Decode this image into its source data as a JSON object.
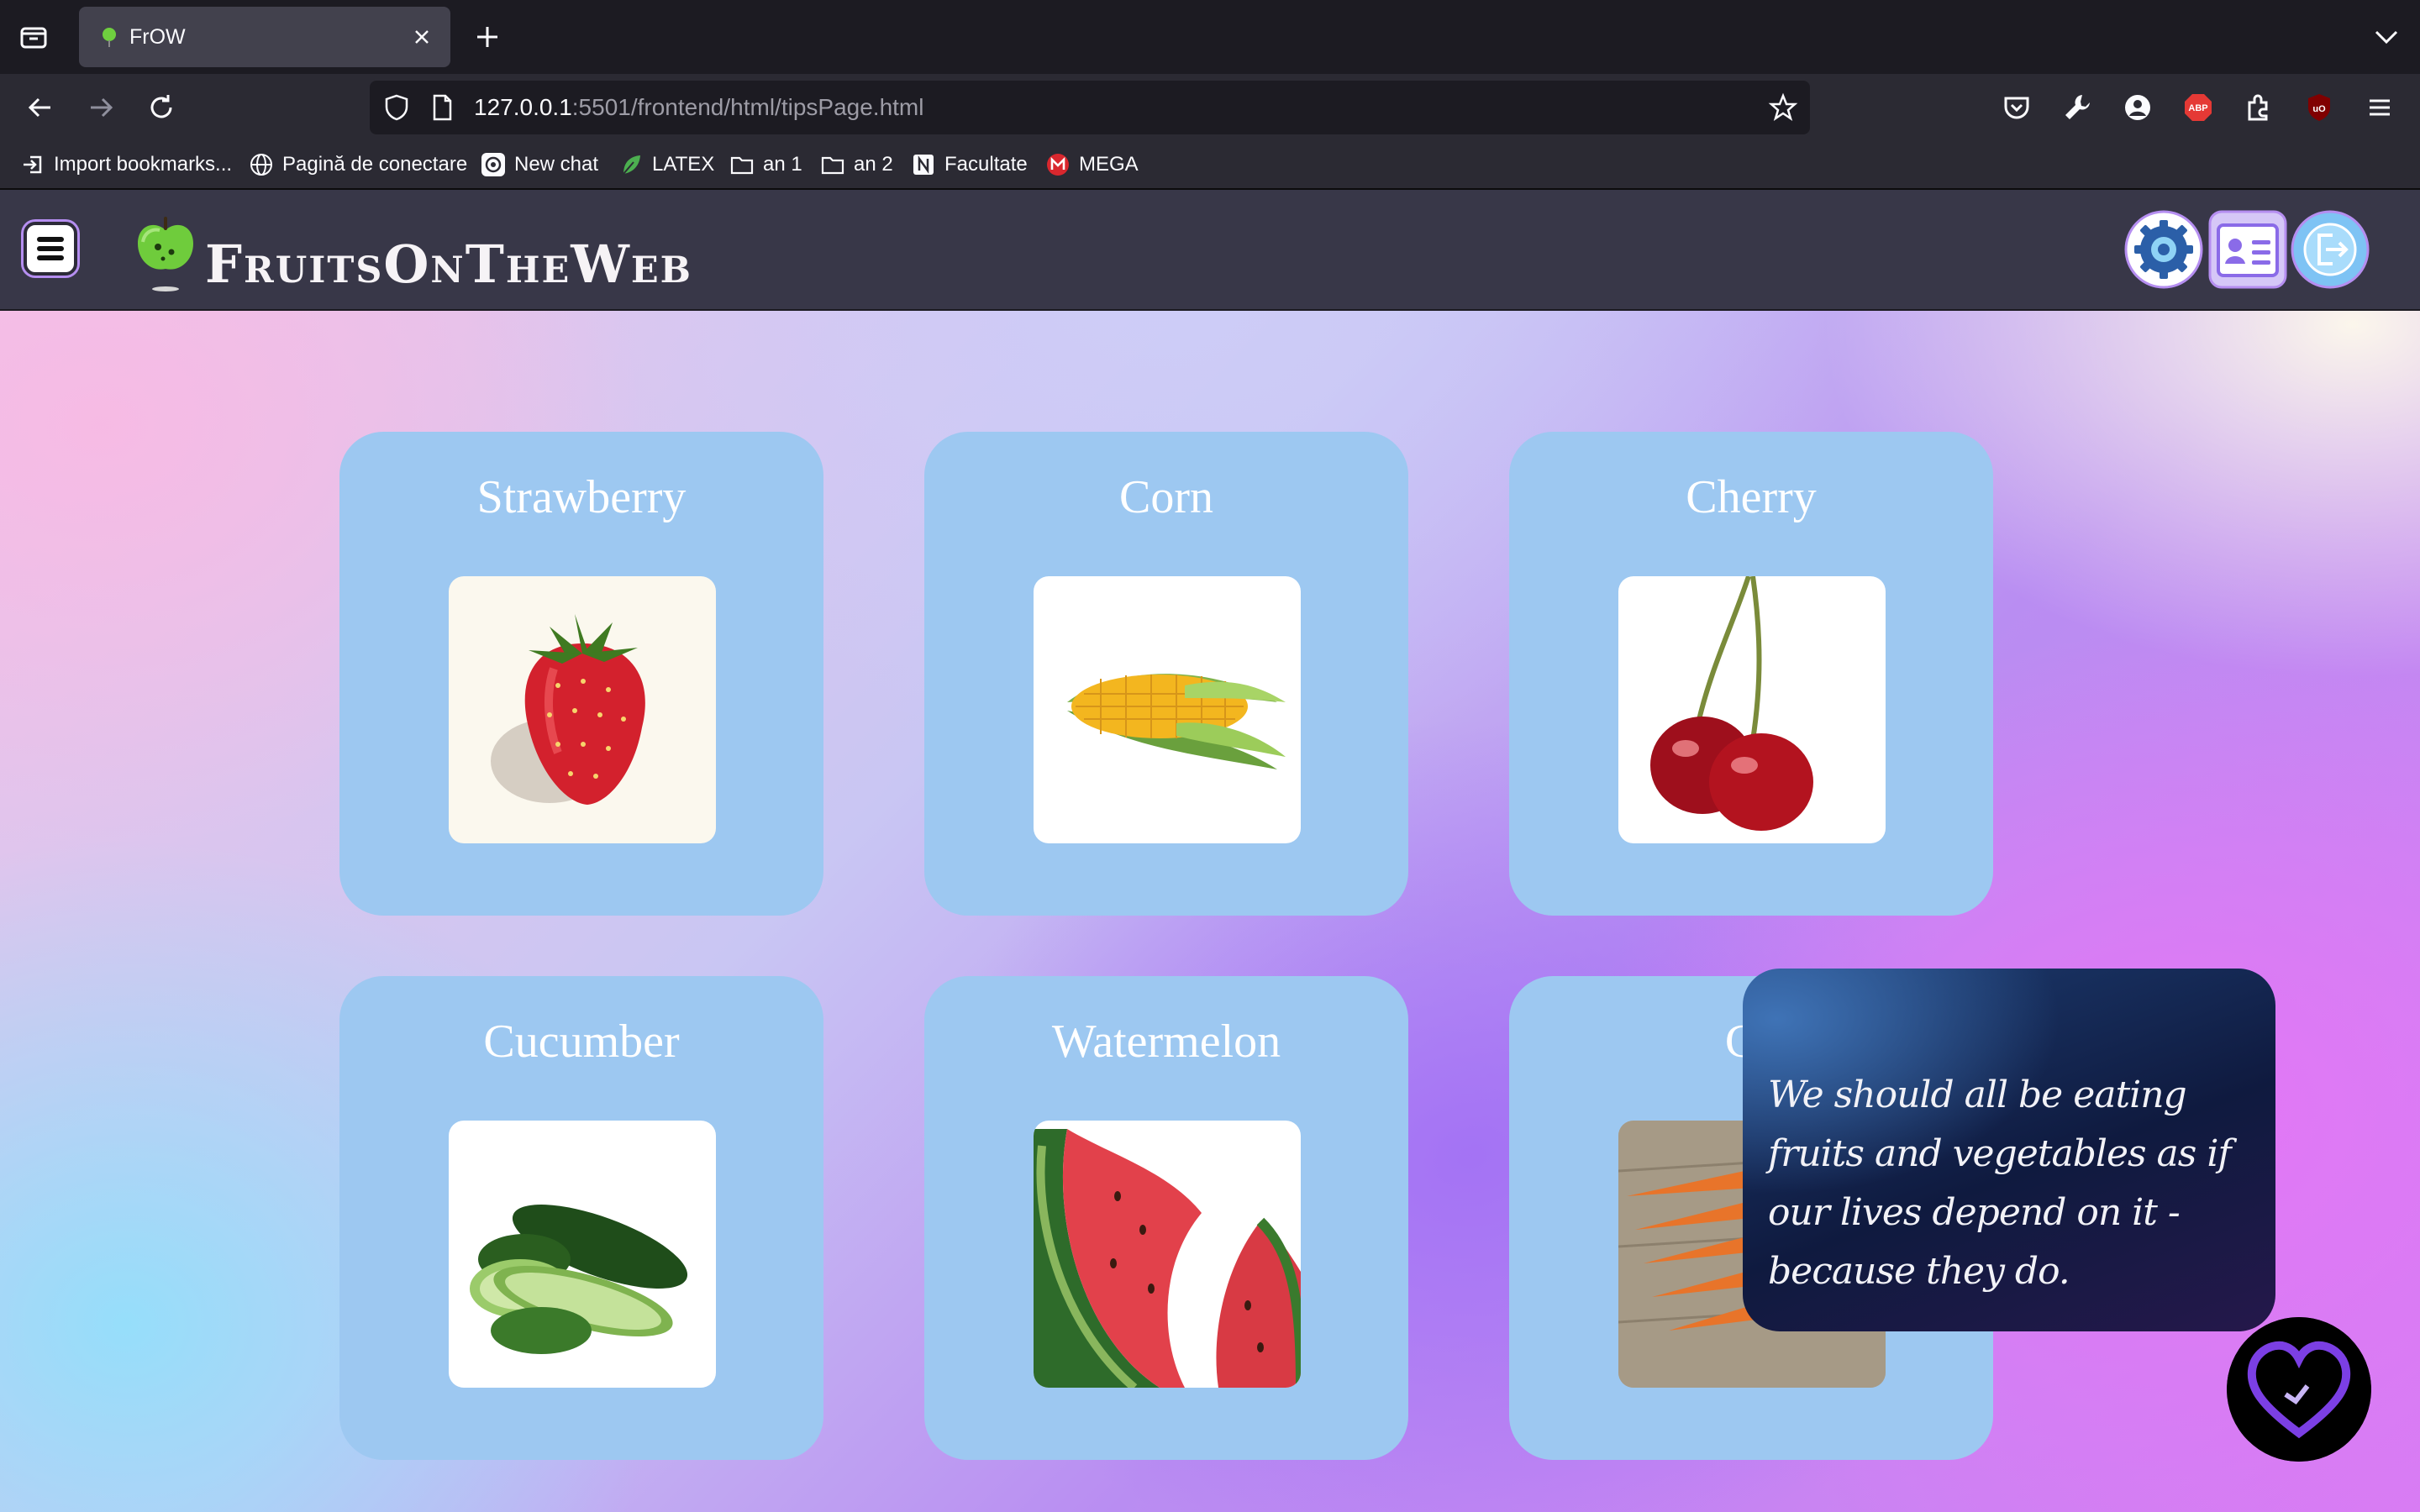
{
  "browser": {
    "tab": {
      "title": "FrOW"
    },
    "url": {
      "host": "127.0.0.1",
      "rest": ":5501/frontend/html/tipsPage.html"
    },
    "bookmarks": [
      {
        "label": "Import bookmarks...",
        "icon": "import-icon"
      },
      {
        "label": "Pagină de conectare",
        "icon": "globe-icon"
      },
      {
        "label": "New chat",
        "icon": "openai-icon"
      },
      {
        "label": "LATEX",
        "icon": "leaf-icon"
      },
      {
        "label": "an 1",
        "icon": "folder-icon"
      },
      {
        "label": "an 2",
        "icon": "folder-icon"
      },
      {
        "label": "Facultate",
        "icon": "notion-icon"
      },
      {
        "label": "MEGA",
        "icon": "mega-icon"
      }
    ]
  },
  "header": {
    "brand": "FruitsOnTheWeb",
    "buttons": [
      "settings-icon",
      "profile-card-icon",
      "logout-icon"
    ]
  },
  "cards": [
    {
      "title": "Strawberry",
      "image": "strawberry"
    },
    {
      "title": "Corn",
      "image": "corn"
    },
    {
      "title": "Cherry",
      "image": "cherry"
    },
    {
      "title": "Cucumber",
      "image": "cucumber"
    },
    {
      "title": "Watermelon",
      "image": "watermelon"
    },
    {
      "title": "Ca",
      "image": "carrot"
    }
  ],
  "quote": {
    "text": "We should all be eating fruits and vegetables as if our lives depend on it - because they do."
  },
  "colors": {
    "card": "#9dc8f1",
    "header": "#383748",
    "accent": "#7b3fe4"
  }
}
